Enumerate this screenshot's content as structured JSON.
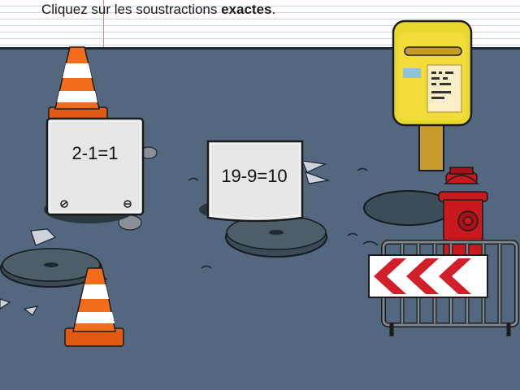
{
  "instruction": {
    "prefix": "Cliquez sur les soustractions ",
    "emphasis": "exactes",
    "suffix": "."
  },
  "cards": [
    {
      "expression": "2-1=1"
    },
    {
      "expression": "19-9=10"
    }
  ],
  "colors": {
    "ground": "#53677e",
    "cone_orange": "#f26d1b",
    "mailbox_yellow": "#e8d72c",
    "hydrant_red": "#c8191e",
    "chevron_red": "#d32028"
  }
}
